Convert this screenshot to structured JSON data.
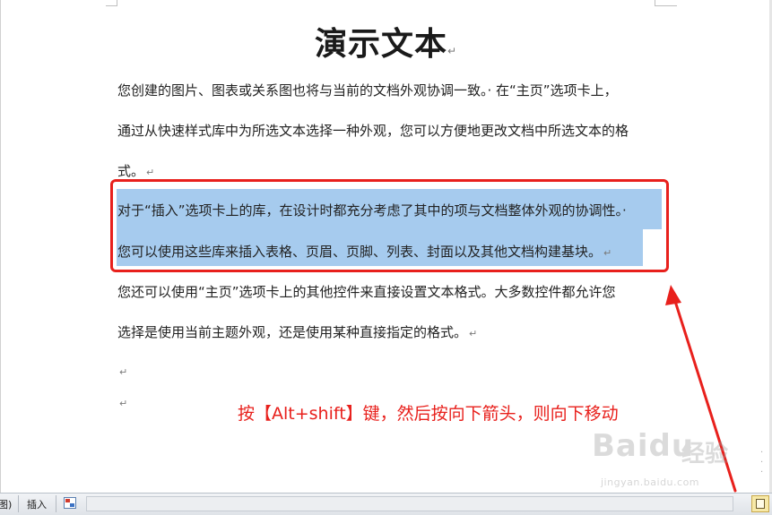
{
  "document": {
    "title": "演示文本",
    "paragraph_mark": "↵",
    "lines": [
      "您创建的图片、图表或关系图也将与当前的文档外观协调一致。· 在“主页”选项卡上，",
      "通过从快速样式库中为所选文本选择一种外观，您可以方便地更改文档中所选文本的格",
      "式。",
      "对于“插入”选项卡上的库，在设计时都充分考虑了其中的项与文档整体外观的协调性。·",
      "您可以使用这些库来插入表格、页眉、页脚、列表、封面以及其他文档构建基块。",
      "您还可以使用“主页”选项卡上的其他控件来直接设置文本格式。大多数控件都允许您",
      "选择是使用当前主题外观，还是使用某种直接指定的格式。"
    ]
  },
  "annotation": {
    "text": "按【Alt+shift】键，然后按向下箭头，则向下移动",
    "color": "#e8201c"
  },
  "selection_color": "#a6cbee",
  "watermark": {
    "logo": "Bai",
    "logo_tail": "du",
    "cn": "经验",
    "url": "jingyan.baidu.com"
  },
  "statusbar": {
    "left_fragment": "图)",
    "insert_mode": "插入"
  }
}
